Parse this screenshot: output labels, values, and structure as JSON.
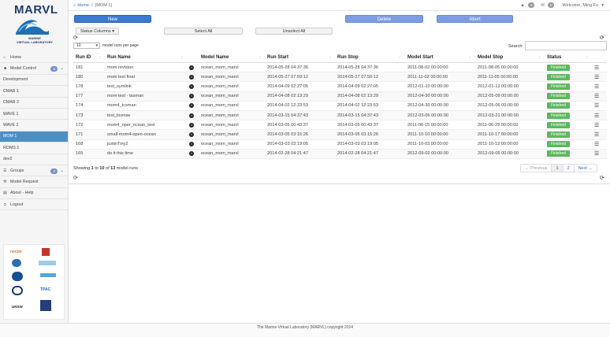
{
  "app": {
    "logo_title": "MARVL",
    "logo_subtitle_1": "MARINE",
    "logo_subtitle_2": "VIRTUAL LABORATORY",
    "brand_color": "#1f3b6e"
  },
  "topbar": {
    "home": "Home",
    "sep": "/",
    "current": "{MOM 1}",
    "alerts_count": "0",
    "messages_count": "0",
    "welcome": "Welcome, Ming Fu"
  },
  "sidebar": {
    "home": "Home",
    "model_control": "Model Control",
    "model_control_badge": "6",
    "items": [
      "Development",
      "CMAR 1",
      "CMAR 2",
      "WAVE 1",
      "WAVE 2",
      "MOM 1",
      "ROMS 1",
      "dev2"
    ],
    "active": "MOM 1",
    "groups": "Groups",
    "groups_badge": "2",
    "model_request": "Model Request",
    "about": "About - Help",
    "logout": "Logout"
  },
  "partners": {
    "p1": "nectar",
    "p2": "UTAS",
    "p3": "CSIRO",
    "p4": "IMOS",
    "p5": "AURIN",
    "p6": "NCI",
    "p7": "RDS",
    "p8": "TPAC",
    "p9": "UNSW",
    "p10": "Univ"
  },
  "actions": {
    "new": "New",
    "delete": "Delete",
    "abort": "Abort",
    "status_columns": "Status Columns",
    "select_all": "Select All",
    "unselect_all": "Unselect All"
  },
  "table_controls": {
    "per_page": "10",
    "per_page_label": "model runs per page",
    "search_label": "Search:",
    "search_value": ""
  },
  "table": {
    "headers": [
      "Run ID",
      "Run Name",
      "",
      "Model Name",
      "Run Start",
      "Run Stop",
      "Model Start",
      "Model Stop",
      "Status",
      ""
    ],
    "rows": [
      [
        "181",
        "mom revision",
        "ocean_mom_marvl",
        "2014-05-28 04:37:36",
        "2014-05-28 04:37:36",
        "2011-08-02 00:00:00",
        "2011-08-05 00:00:00",
        "Finished"
      ],
      [
        "180",
        "mom test final",
        "ocean_mom_marvl",
        "2014-05-27 07:59:12",
        "2014-05-27 07:59:12",
        "2011-11-02 00:00:00",
        "2011-11-05 00:00:00",
        "Finished"
      ],
      [
        "178",
        "test_symlink",
        "ocean_mom_marvl",
        "2014-04-09 02:27:05",
        "2014-04-09 02:27:05",
        "2012-01-10 00:00:00",
        "2012-01-12 00:00:00",
        "Finished"
      ],
      [
        "177",
        "mom test - tasman",
        "ocean_mom_marvl",
        "2014-04-08 02:13:29",
        "2014-04-08 02:13:29",
        "2012-04-30 00:00:00",
        "2012-05-09 00:00:00",
        "Finished"
      ],
      [
        "174",
        "mom4_tcsman",
        "ocean_mom_marvl",
        "2014-04-02 12:23:53",
        "2014-04-02 12:23:53",
        "2012-04-30 00:00:00",
        "2012-05-06 00:00:00",
        "Finished"
      ],
      [
        "173",
        "test_license",
        "ocean_mom_marvl",
        "2014-03-15 04:37:43",
        "2014-03-15 04:37:43",
        "2012-03-06 00:00:00",
        "2012-03-21 00:00:00",
        "Finished"
      ],
      [
        "172",
        "mom4_oper_ocean_test",
        "ocean_mom_marvl",
        "2014-03-05 00:43:37",
        "2014-03-05 00:43:37",
        "2011-06-15 00:00:00",
        "2011-06-29 00:00:00",
        "Finished"
      ],
      [
        "171",
        "small-mom4-open-ocean",
        "ocean_mom_marvl",
        "2014-03-05 03:15:26",
        "2014-03-05 03:15:26",
        "2011-10-10 00:00:00",
        "2011-10-17 00:00:00",
        "Finished"
      ],
      [
        "168",
        "justinTiny2",
        "ocean_mom_marvl",
        "2014-03-03 03:19:05",
        "2014-03-03 03:19:05",
        "2011-10-03 00:00:00",
        "2011-10-12 00:00:00",
        "Finished"
      ],
      [
        "165",
        "do it this time",
        "ocean_mom_marvl",
        "2014-02-28 04:21:47",
        "2014-02-28 04:21:47",
        "2012-09-02 00:00:00",
        "2012-09-05 00:00:00",
        "Finished"
      ]
    ]
  },
  "pagination": {
    "showing_pre": "Showing",
    "from": "1",
    "to_word": "to",
    "to": "10",
    "of_word": "of",
    "total": "13",
    "showing_post": "model runs",
    "previous": "← Previous",
    "page1": "1",
    "page2": "2",
    "next": "Next →"
  },
  "footer": {
    "text": "The Marine Virtual Laboratory (MARVL) copyright 2014"
  },
  "colors": {
    "primary_button": "#3a7ad1",
    "delete_abort_button": "#7c9ee0",
    "status_finished": "#5cb85c",
    "sidebar_active": "#4a90c7"
  }
}
